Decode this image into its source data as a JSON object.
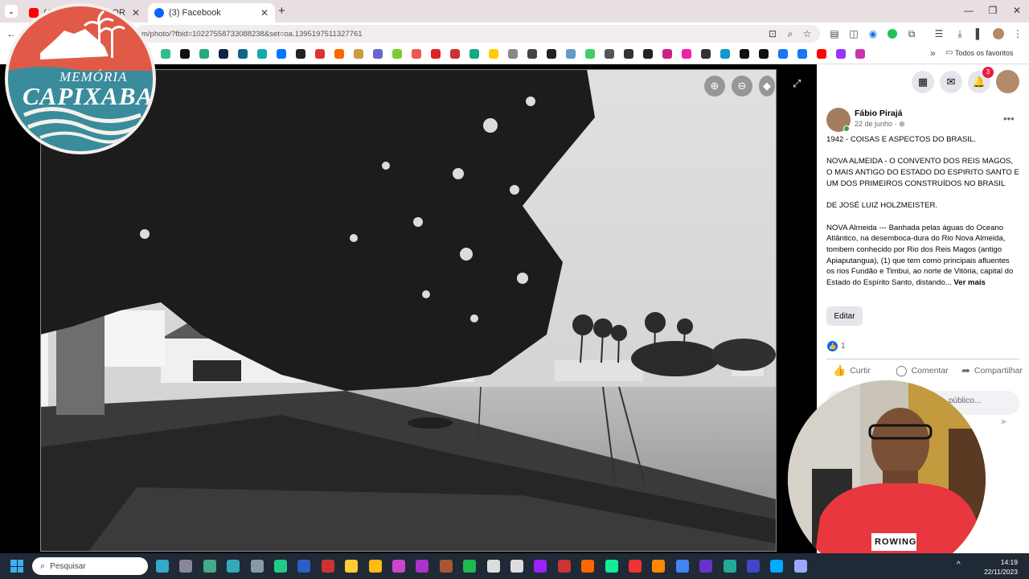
{
  "browser": {
    "tabs": [
      {
        "label": "(4) ...",
        "label2": "... COR",
        "favicon": "youtube-icon",
        "active": false
      },
      {
        "label": "(3) Facebook",
        "favicon": "facebook-icon",
        "active": true
      }
    ],
    "new_tab": "+",
    "url": "m/photo/?fbid=10227558733088238&set=oa.1395197511327761",
    "all_favorites": "Todos os favoritos"
  },
  "logo": {
    "line1": "MEMÓRIA",
    "line2": "CAPIXABA",
    "colors": {
      "top": "#e05a47",
      "bottom": "#3a8b9c",
      "ring": "#f5f1ea"
    }
  },
  "post": {
    "author": "Fábio Pirajá",
    "date": "22 de junho",
    "privacy": "·",
    "paragraphs": [
      "1942 - COISAS E ASPECTOS DO BRASIL.",
      "NOVA ALMEIDA - O CONVENTO DOS REIS MAGOS, O MAIS ANTIGO DO ESTADO DO ESPIRITO SANTO E UM DOS PRIMEIROS CONSTRUÍDOS NO BRASIL",
      "DE JOSÉ LUIZ HOLZMEISTER.",
      "NOVA Almeida --- Banhada pelas águas do Oceano Atlântico, na desemboca-dura do Rio Nova Almeida, tombem conhecido por Rio dos Reis Magos (antigo Apiaputangua), (1) que tem como principais afluentes os rios Fundão e Timbui, ao norte de Vitória, capital do Estado do Espírito Santo, distando..."
    ],
    "see_more": "Ver mais",
    "edit_label": "Editar",
    "reaction_count": "1",
    "actions": {
      "like": "Curtir",
      "comment": "Comentar",
      "share": "Compartilhar"
    },
    "comment_placeholder": "público...",
    "notification_badge": "3"
  },
  "taskbar": {
    "search_placeholder": "Pesquisar",
    "time": "14:19",
    "date": "22/11/2023"
  },
  "webcam": {
    "shirt_text": "ROWING"
  },
  "colors": {
    "facebook_blue": "#0866ff",
    "badge_red": "#e41e3f"
  }
}
